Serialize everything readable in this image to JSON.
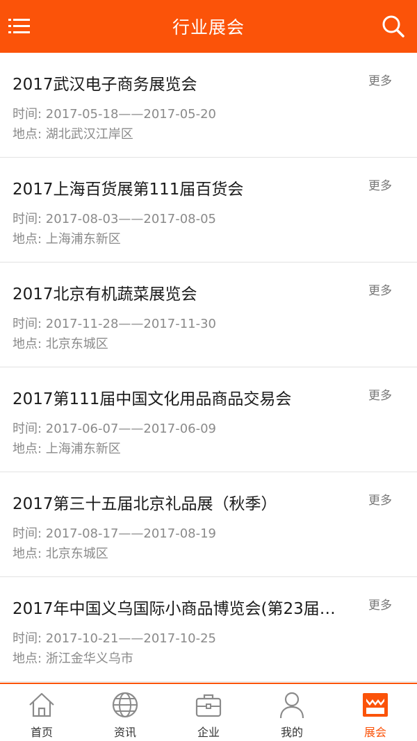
{
  "header": {
    "title": "行业展会",
    "menu_icon": "menu-icon",
    "search_icon": "search-icon",
    "bg_color": "#fb5309"
  },
  "exhibitions": [
    {
      "name": "2017武汉电子商务展览会",
      "more": "更多",
      "time": "时间: 2017-05-18——2017-05-20",
      "place": "地点: 湖北武汉江岸区"
    },
    {
      "name": "2017上海百货展第111届百货会",
      "more": "更多",
      "time": "时间: 2017-08-03——2017-08-05",
      "place": "地点: 上海浦东新区"
    },
    {
      "name": "2017北京有机蔬菜展览会",
      "more": "更多",
      "time": "时间: 2017-11-28——2017-11-30",
      "place": "地点: 北京东城区"
    },
    {
      "name": "2017第111届中国文化用品商品交易会",
      "more": "更多",
      "time": "时间: 2017-06-07——2017-06-09",
      "place": "地点: 上海浦东新区"
    },
    {
      "name": "2017第三十五届北京礼品展（秋季）",
      "more": "更多",
      "time": "时间: 2017-08-17——2017-08-19",
      "place": "地点: 北京东城区"
    },
    {
      "name": "2017年中国义乌国际小商品博览会(第23届…",
      "more": "更多",
      "time": "时间: 2017-10-21——2017-10-25",
      "place": "地点: 浙江金华义乌市"
    }
  ],
  "tabbar": {
    "tabs": [
      {
        "label": "首页",
        "icon": "home-icon"
      },
      {
        "label": "资讯",
        "icon": "globe-icon"
      },
      {
        "label": "企业",
        "icon": "briefcase-icon"
      },
      {
        "label": "我的",
        "icon": "user-icon"
      },
      {
        "label": "展会",
        "icon": "exhibition-icon"
      }
    ],
    "active_index": 4,
    "active_color": "#fb5309",
    "inactive_color": "#8a8a8a"
  }
}
